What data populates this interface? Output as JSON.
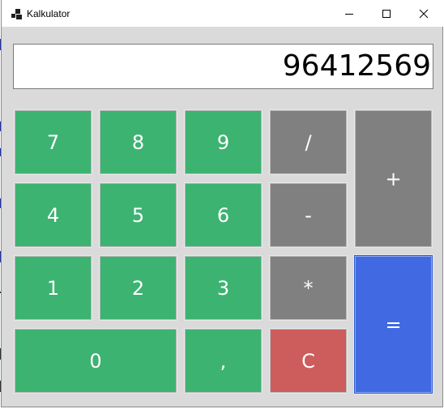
{
  "window": {
    "title": "Kalkulator",
    "controls": {
      "minimize_icon": "minimize-icon",
      "maximize_icon": "maximize-icon",
      "close_icon": "close-icon"
    }
  },
  "display": {
    "value": "96412569"
  },
  "keys": {
    "seven": "7",
    "eight": "8",
    "nine": "9",
    "divide": "/",
    "plus": "+",
    "four": "4",
    "five": "5",
    "six": "6",
    "minus": "-",
    "one": "1",
    "two": "2",
    "three": "3",
    "multiply": "*",
    "equals": "=",
    "zero": "0",
    "comma": ",",
    "clear": "C"
  },
  "colors": {
    "digit_key": "#3cb371",
    "operator_key": "#808080",
    "clear_key": "#cd5c5c",
    "equals_key": "#4169e1",
    "window_bg": "#dadada"
  }
}
